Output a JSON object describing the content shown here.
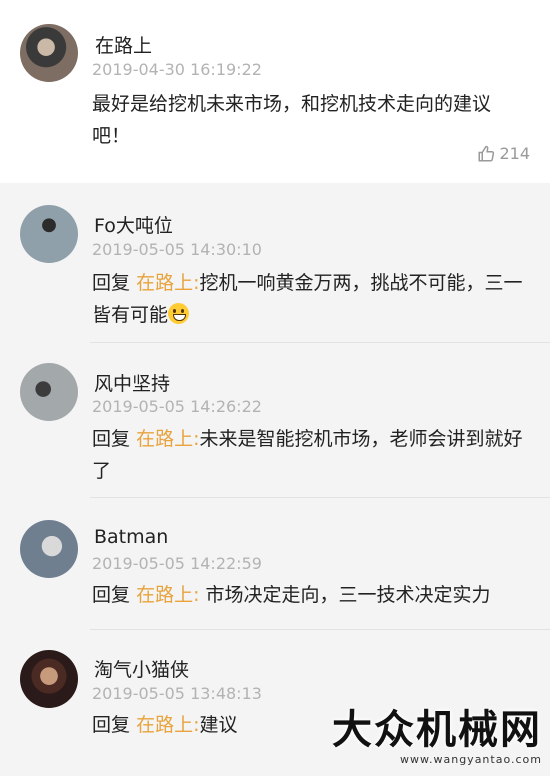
{
  "main": {
    "username": "在路上",
    "time": "2019-04-30 16:19:22",
    "text": "最好是给挖机未来市场，和挖机技术走向的建议吧！",
    "likes": "214",
    "avatar_color": "#6a6a6a"
  },
  "replies": [
    {
      "username": "Fo大吨位",
      "time": "2019-05-05 14:30:10",
      "reply_label": "回复",
      "mention": "在路上:",
      "text": "挖机一响黄金万两，挑战不可能，三一皆有可能",
      "emoji": true
    },
    {
      "username": "风中坚持",
      "time": "2019-05-05 14:26:22",
      "reply_label": "回复",
      "mention": "在路上:",
      "text": "未来是智能挖机市场，老师会讲到就好了"
    },
    {
      "username": "Batman",
      "time": "2019-05-05 14:22:59",
      "reply_label": "回复",
      "mention": "在路上:",
      "text": " 市场决定走向，三一技术决定实力"
    },
    {
      "username": "淘气小猫侠",
      "time": "2019-05-05 13:48:13",
      "reply_label": "回复",
      "mention": "在路上:",
      "text": "建议"
    }
  ],
  "watermark": {
    "title": "大众机械网",
    "url": "www.wangyantao.com"
  },
  "colors": {
    "mention": "#e8a33d",
    "time": "#b3b3b3",
    "reply_bg": "#f4f4f4"
  }
}
